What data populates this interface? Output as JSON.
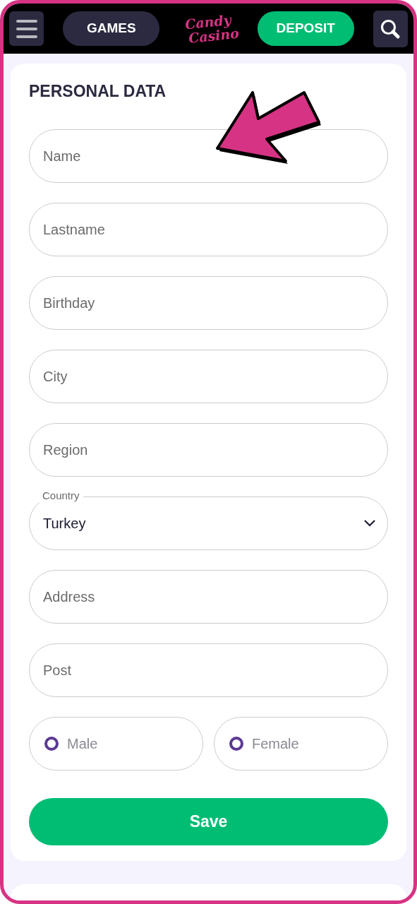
{
  "header": {
    "games_button": "GAMES",
    "logo": [
      "Candy",
      "Casino"
    ],
    "deposit_button": "DEPOSIT"
  },
  "form": {
    "title": "PERSONAL DATA",
    "fields": [
      {
        "kind": "text",
        "placeholder": "Name"
      },
      {
        "kind": "text",
        "placeholder": "Lastname"
      },
      {
        "kind": "text",
        "placeholder": "Birthday"
      },
      {
        "kind": "text",
        "placeholder": "City"
      },
      {
        "kind": "text",
        "placeholder": "Region"
      },
      {
        "kind": "select",
        "label": "Country",
        "value": "Turkey"
      },
      {
        "kind": "text",
        "placeholder": "Address"
      },
      {
        "kind": "text",
        "placeholder": "Post"
      }
    ],
    "gender": [
      {
        "label": "Male",
        "selected": false
      },
      {
        "label": "Female",
        "selected": false
      }
    ],
    "save_button": "Save"
  }
}
